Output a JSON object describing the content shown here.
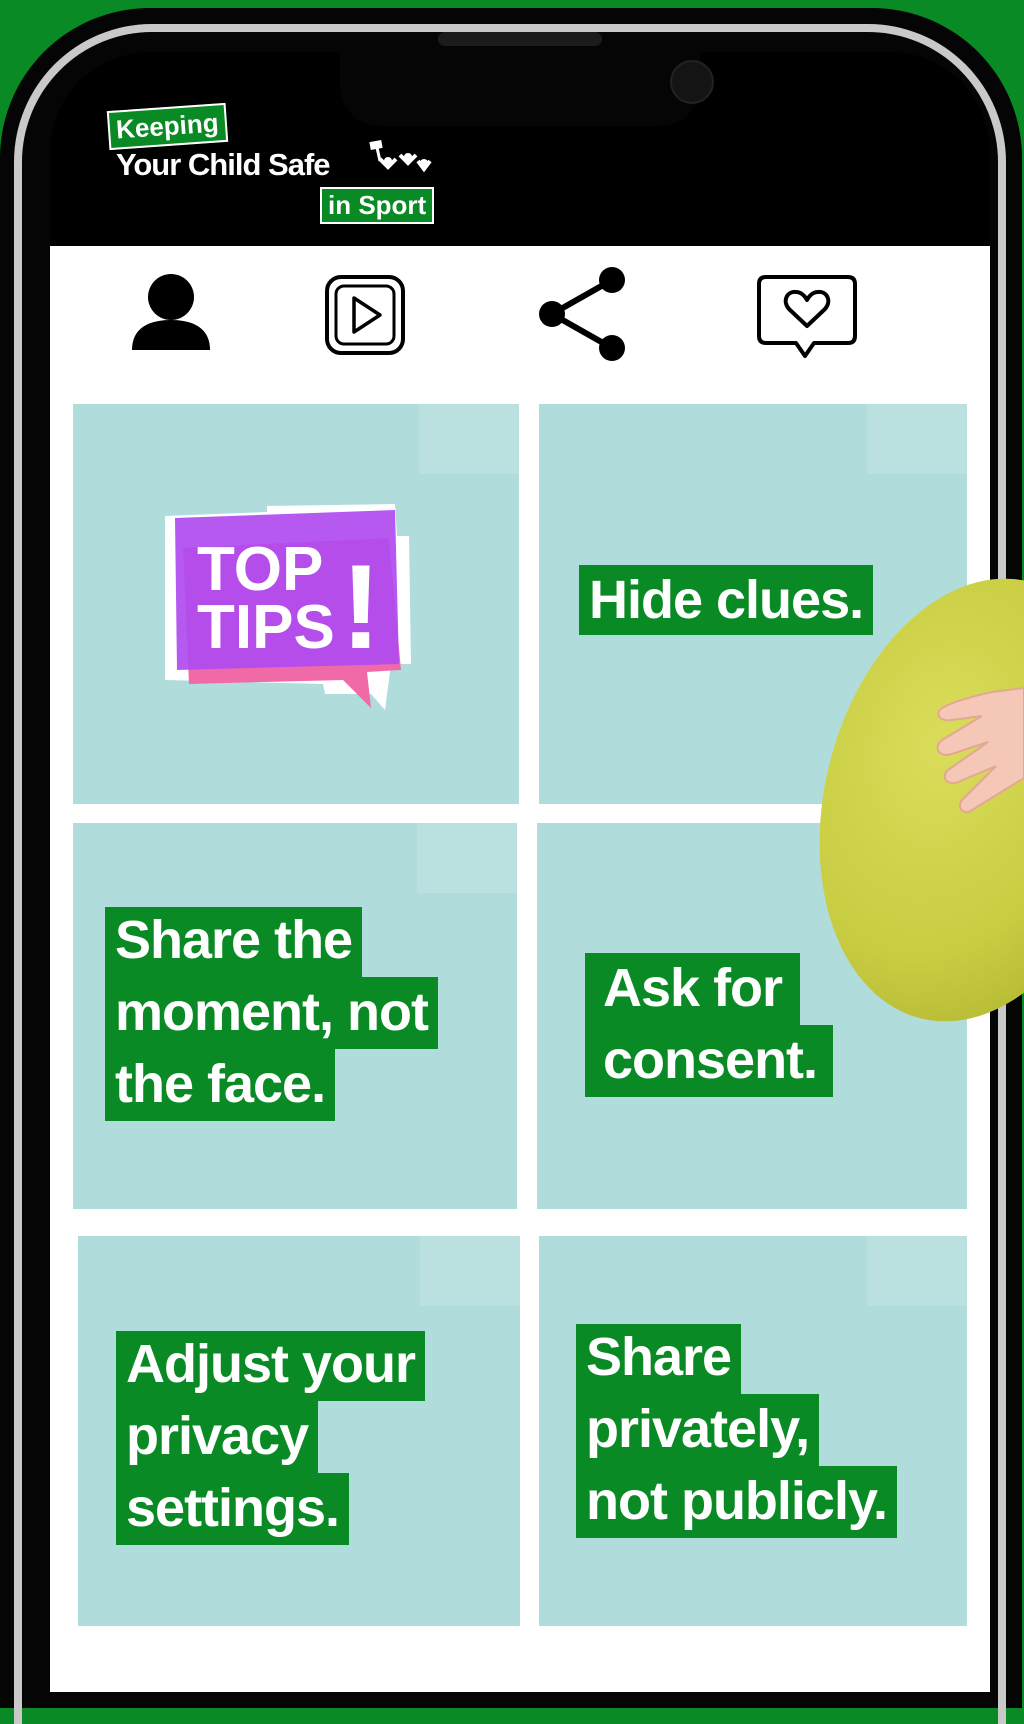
{
  "brand": {
    "keeping": "Keeping",
    "your_child_safe": "Your Child Safe",
    "in_sport": "in Sport"
  },
  "toolbar": {
    "icons": [
      "user-icon",
      "play-icon",
      "share-icon",
      "heart-message-icon"
    ]
  },
  "tiles": [
    {
      "id": "top-tips",
      "badge_line1": "TOP",
      "badge_line2": "TIPS",
      "badge_mark": "!"
    },
    {
      "id": "hide-clues",
      "lines": [
        "Hide clues."
      ]
    },
    {
      "id": "share-moment",
      "lines": [
        "Share the",
        "moment, not",
        "the face."
      ]
    },
    {
      "id": "ask-consent",
      "lines": [
        "Ask for",
        "consent."
      ]
    },
    {
      "id": "adjust-privacy",
      "lines": [
        "Adjust your",
        "privacy",
        "settings."
      ]
    },
    {
      "id": "share-privately",
      "lines": [
        "Share",
        "privately,",
        "not publicly."
      ]
    }
  ],
  "colors": {
    "background_green": "#0a8a24",
    "tile_blue": "#b1dcdc",
    "badge_purple": "#b04bf0",
    "badge_pink": "#f06aa8",
    "label_green": "#0a8a24"
  }
}
